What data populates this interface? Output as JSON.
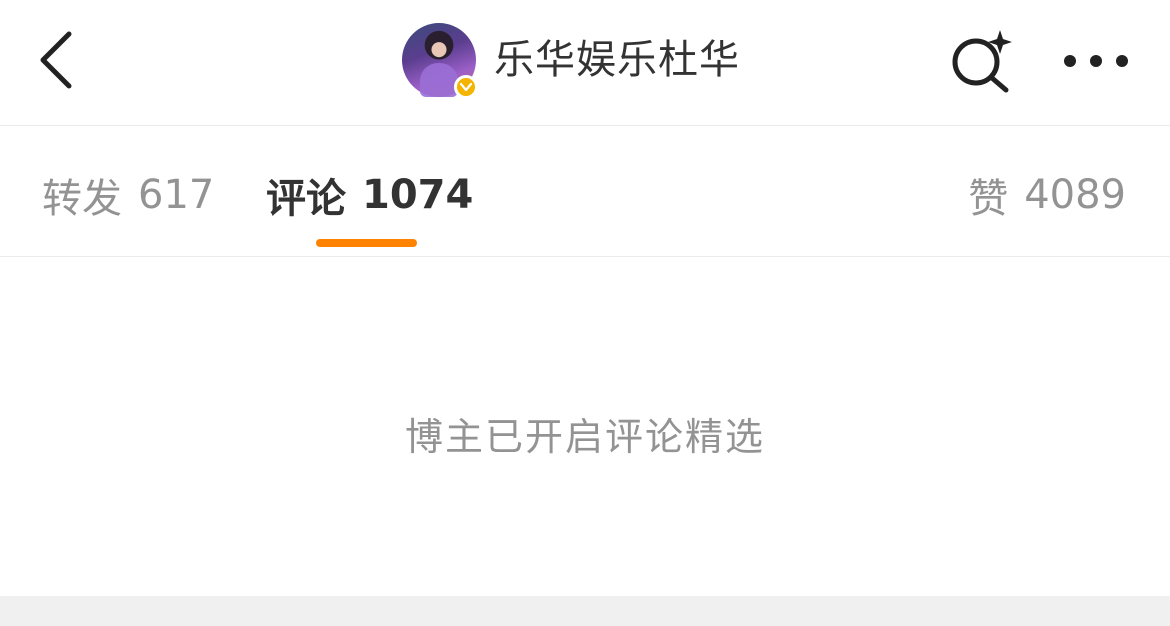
{
  "header": {
    "back_icon": "chevron-left-icon",
    "username": "乐华娱乐杜华",
    "verified_badge_color": "#f4b400",
    "search_icon": "search-sparkle-icon",
    "more_icon": "more-horizontal-icon"
  },
  "tabs": [
    {
      "label": "转发",
      "count": "617",
      "active": false
    },
    {
      "label": "评论",
      "count": "1074",
      "active": true
    },
    {
      "label": "赞",
      "count": "4089",
      "active": false
    }
  ],
  "content": {
    "notice": "博主已开启评论精选"
  },
  "colors": {
    "accent": "#ff8200",
    "text_primary": "#333333",
    "text_secondary": "#939393",
    "divider": "#ececec"
  }
}
